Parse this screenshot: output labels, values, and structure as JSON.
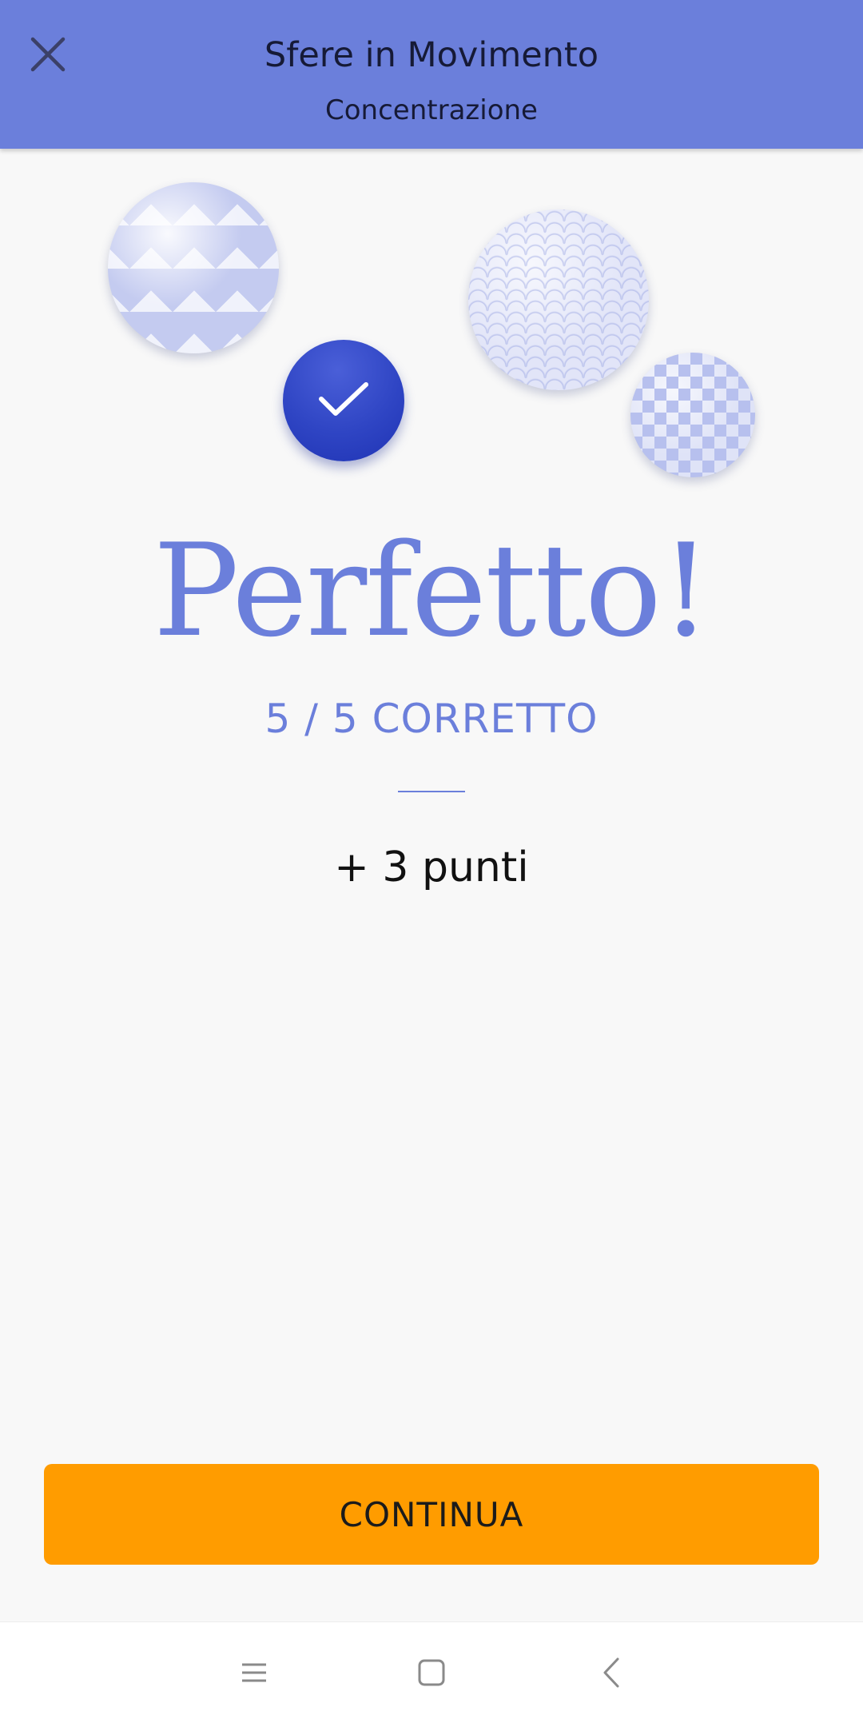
{
  "header": {
    "title": "Sfere in Movimento",
    "subtitle": "Concentrazione",
    "close_icon": "close-icon",
    "background_color": "#6b7fdb"
  },
  "spheres": [
    {
      "name": "houndstooth-sphere",
      "pattern": "houndstooth"
    },
    {
      "name": "scales-sphere",
      "pattern": "scales"
    },
    {
      "name": "stars-sphere",
      "pattern": "stars"
    }
  ],
  "check": {
    "icon": "check-icon",
    "color": "#2f45c4"
  },
  "result": {
    "title": "Perfetto!",
    "score": "5 / 5 CORRETTO",
    "points": "+ 3 punti",
    "accent_color": "#6b7fdb"
  },
  "continue_button": {
    "label": "CONTINUA",
    "color": "#ff9c00"
  },
  "navbar": {
    "menu_icon": "menu-icon",
    "home_icon": "home-icon",
    "back_icon": "back-icon"
  }
}
